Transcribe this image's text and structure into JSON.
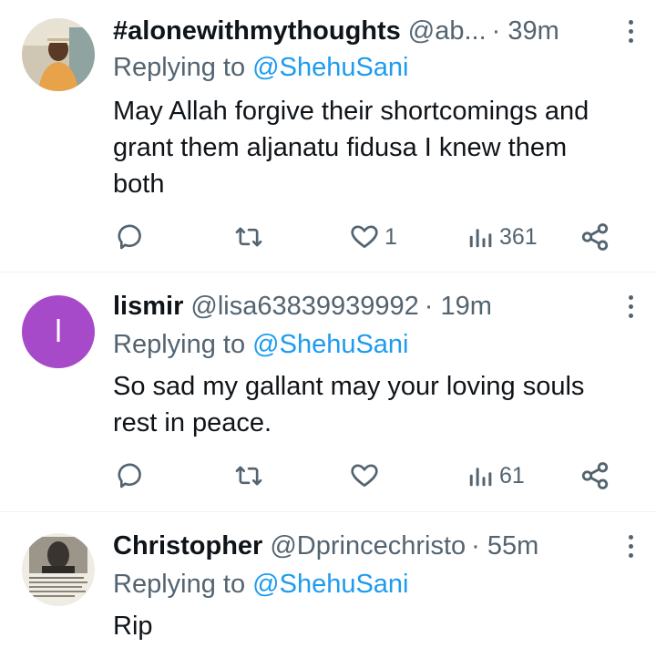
{
  "tweets": [
    {
      "display_name": "#alonewithmythoughts",
      "handle": "@ab...",
      "time": "· 39m",
      "replying_prefix": "Replying to",
      "replying_to": "@ShehuSani",
      "body_lines": [
        "May Allah forgive their shortcomings and",
        "grant them aljanatu fidusa I knew them",
        "both"
      ],
      "likes": "1",
      "views": "361",
      "avatar": "photo-man-cap"
    },
    {
      "display_name": "lismir",
      "handle": "@lisa63839939992",
      "time": "· 19m",
      "replying_prefix": "Replying to",
      "replying_to": "@ShehuSani",
      "body_lines": [
        "So sad my gallant may your loving souls",
        "rest in peace."
      ],
      "likes": "",
      "views": "61",
      "avatar": "letter",
      "avatar_letter": "l",
      "avatar_color": "#a64ac9"
    },
    {
      "display_name": "Christopher",
      "handle": "@Dprincechristo",
      "time": "· 55m",
      "replying_prefix": "Replying to",
      "replying_to": "@ShehuSani",
      "body_lines": [
        "Rip"
      ],
      "avatar": "photo-newspaper"
    }
  ],
  "colors": {
    "text": "#0f1419",
    "muted": "#536471",
    "link": "#1d9bf0",
    "divider": "#eff3f4"
  },
  "icons": [
    "reply-icon",
    "retweet-icon",
    "like-icon",
    "views-icon",
    "share-icon",
    "more-icon"
  ]
}
